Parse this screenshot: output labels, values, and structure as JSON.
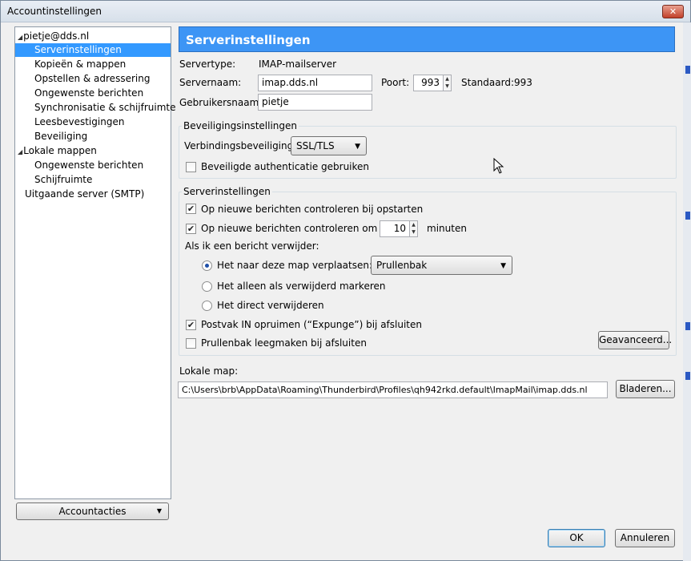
{
  "window": {
    "title": "Accountinstellingen",
    "close_label": "✕"
  },
  "sidebar": {
    "items": [
      {
        "label": "pietje@dds.nl",
        "expanded": true
      },
      {
        "label": "Serverinstellingen",
        "selected": true
      },
      {
        "label": "Kopieën & mappen"
      },
      {
        "label": "Opstellen & adressering"
      },
      {
        "label": "Ongewenste berichten"
      },
      {
        "label": "Synchronisatie & schijfruimte"
      },
      {
        "label": "Leesbevestigingen"
      },
      {
        "label": "Beveiliging"
      },
      {
        "label": "Lokale mappen",
        "expanded": true
      },
      {
        "label": "Ongewenste berichten"
      },
      {
        "label": "Schijfruimte"
      },
      {
        "label": "Uitgaande server (SMTP)"
      }
    ],
    "account_actions_label": "Accountacties"
  },
  "main": {
    "header": "Serverinstellingen",
    "servertype_label": "Servertype:",
    "servertype_value": "IMAP-mailserver",
    "servername_label": "Servernaam:",
    "servername_value": "imap.dds.nl",
    "port_label": "Poort:",
    "port_value": "993",
    "default_label": "Standaard:",
    "default_value": "993",
    "username_label": "Gebruikersnaam:",
    "username_value": "pietje"
  },
  "security": {
    "group_title": "Beveiligingsinstellingen",
    "connection_label": "Verbindingsbeveiliging:",
    "connection_value": "SSL/TLS",
    "secure_auth_label": "Beveiligde authenticatie gebruiken",
    "secure_auth_checked": false
  },
  "server": {
    "group_title": "Serverinstellingen",
    "check_startup_label": "Op nieuwe berichten controleren bij opstarten",
    "check_startup_checked": true,
    "check_every_label": "Op nieuwe berichten controleren om de",
    "check_every_checked": true,
    "check_every_value": "10",
    "minutes_label": "minuten",
    "on_delete_label": "Als ik een bericht verwijder:",
    "move_label": "Het naar deze map verplaatsen:",
    "move_folder_value": "Prullenbak",
    "mark_label": "Het alleen als verwijderd markeren",
    "delete_label": "Het direct verwijderen",
    "delete_option_selected": "move",
    "expunge_label": "Postvak IN opruimen (“Expunge”) bij afsluiten",
    "expunge_checked": true,
    "empty_trash_label": "Prullenbak leegmaken bij afsluiten",
    "empty_trash_checked": false,
    "advanced_label": "Geavanceerd..."
  },
  "local": {
    "label": "Lokale map:",
    "path_value": "C:\\Users\\brb\\AppData\\Roaming\\Thunderbird\\Profiles\\qh942rkd.default\\ImapMail\\imap.dds.nl",
    "browse_label": "Bladeren..."
  },
  "footer": {
    "ok_label": "OK",
    "cancel_label": "Annuleren"
  },
  "colors": {
    "header_bg": "#3d95f5",
    "selection": "#3399ff"
  },
  "icons": {
    "check": "✔",
    "triangle": "◢",
    "dropdown": "▼",
    "spin_up": "▲",
    "spin_down": "▼"
  }
}
